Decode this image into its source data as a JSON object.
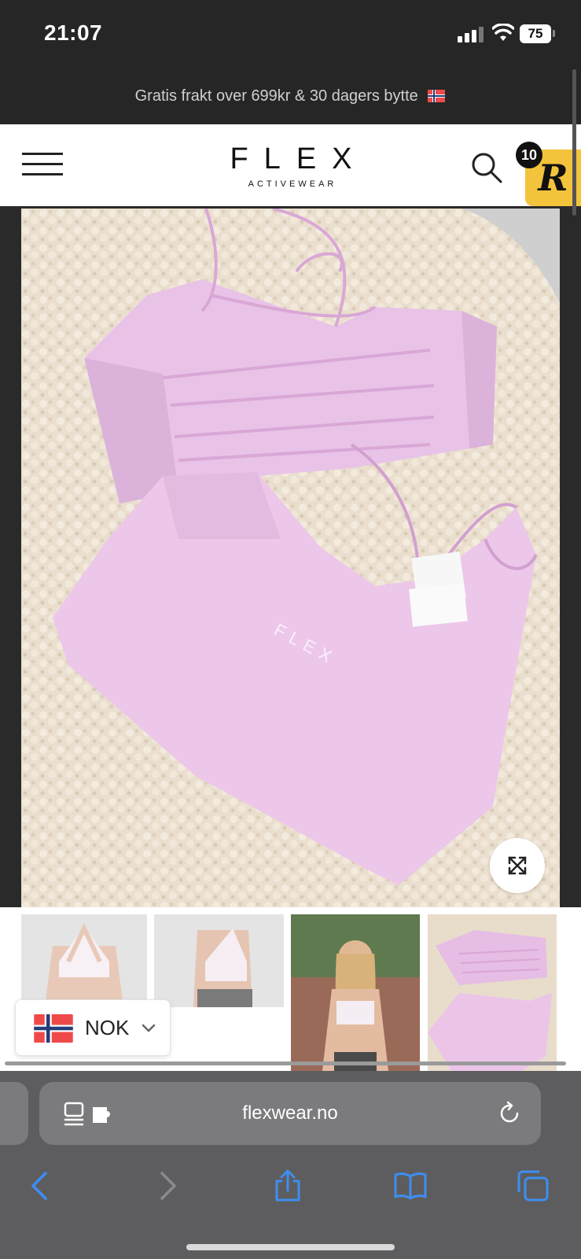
{
  "status_bar": {
    "time": "21:07",
    "battery": "75"
  },
  "promo": {
    "text": "Gratis frakt over 699kr & 30 dagers bytte"
  },
  "header": {
    "logo_main": "FLEX",
    "logo_sub": "ACTIVEWEAR",
    "cart_count": "10",
    "reviews_badge": "R"
  },
  "gallery": {
    "main_image_label": "FLEX",
    "thumbnails": [
      "Front view",
      "Side view",
      "Model photo",
      "Flat lay"
    ]
  },
  "currency": {
    "label": "NOK"
  },
  "browser": {
    "url": "flexwear.no"
  },
  "colors": {
    "accent_pink": "#e8c6e6",
    "badge_yellow": "#f3c33c",
    "ios_blue": "#3d8ef2"
  },
  "icons": [
    "menu-icon",
    "search-icon",
    "expand-icon",
    "chevron-down-icon",
    "reader-icon",
    "extension-icon",
    "reload-icon",
    "back-icon",
    "forward-icon",
    "share-icon",
    "bookmarks-icon",
    "tabs-icon"
  ]
}
